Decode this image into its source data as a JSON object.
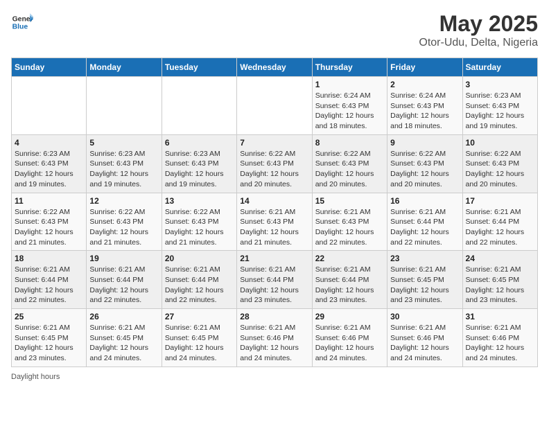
{
  "header": {
    "logo_line1": "General",
    "logo_line2": "Blue",
    "title": "May 2025",
    "subtitle": "Otor-Udu, Delta, Nigeria"
  },
  "days_of_week": [
    "Sunday",
    "Monday",
    "Tuesday",
    "Wednesday",
    "Thursday",
    "Friday",
    "Saturday"
  ],
  "weeks": [
    [
      {
        "day": "",
        "info": ""
      },
      {
        "day": "",
        "info": ""
      },
      {
        "day": "",
        "info": ""
      },
      {
        "day": "",
        "info": ""
      },
      {
        "day": "1",
        "info": "Sunrise: 6:24 AM\nSunset: 6:43 PM\nDaylight: 12 hours and 18 minutes."
      },
      {
        "day": "2",
        "info": "Sunrise: 6:24 AM\nSunset: 6:43 PM\nDaylight: 12 hours and 18 minutes."
      },
      {
        "day": "3",
        "info": "Sunrise: 6:23 AM\nSunset: 6:43 PM\nDaylight: 12 hours and 19 minutes."
      }
    ],
    [
      {
        "day": "4",
        "info": "Sunrise: 6:23 AM\nSunset: 6:43 PM\nDaylight: 12 hours and 19 minutes."
      },
      {
        "day": "5",
        "info": "Sunrise: 6:23 AM\nSunset: 6:43 PM\nDaylight: 12 hours and 19 minutes."
      },
      {
        "day": "6",
        "info": "Sunrise: 6:23 AM\nSunset: 6:43 PM\nDaylight: 12 hours and 19 minutes."
      },
      {
        "day": "7",
        "info": "Sunrise: 6:22 AM\nSunset: 6:43 PM\nDaylight: 12 hours and 20 minutes."
      },
      {
        "day": "8",
        "info": "Sunrise: 6:22 AM\nSunset: 6:43 PM\nDaylight: 12 hours and 20 minutes."
      },
      {
        "day": "9",
        "info": "Sunrise: 6:22 AM\nSunset: 6:43 PM\nDaylight: 12 hours and 20 minutes."
      },
      {
        "day": "10",
        "info": "Sunrise: 6:22 AM\nSunset: 6:43 PM\nDaylight: 12 hours and 20 minutes."
      }
    ],
    [
      {
        "day": "11",
        "info": "Sunrise: 6:22 AM\nSunset: 6:43 PM\nDaylight: 12 hours and 21 minutes."
      },
      {
        "day": "12",
        "info": "Sunrise: 6:22 AM\nSunset: 6:43 PM\nDaylight: 12 hours and 21 minutes."
      },
      {
        "day": "13",
        "info": "Sunrise: 6:22 AM\nSunset: 6:43 PM\nDaylight: 12 hours and 21 minutes."
      },
      {
        "day": "14",
        "info": "Sunrise: 6:21 AM\nSunset: 6:43 PM\nDaylight: 12 hours and 21 minutes."
      },
      {
        "day": "15",
        "info": "Sunrise: 6:21 AM\nSunset: 6:43 PM\nDaylight: 12 hours and 22 minutes."
      },
      {
        "day": "16",
        "info": "Sunrise: 6:21 AM\nSunset: 6:44 PM\nDaylight: 12 hours and 22 minutes."
      },
      {
        "day": "17",
        "info": "Sunrise: 6:21 AM\nSunset: 6:44 PM\nDaylight: 12 hours and 22 minutes."
      }
    ],
    [
      {
        "day": "18",
        "info": "Sunrise: 6:21 AM\nSunset: 6:44 PM\nDaylight: 12 hours and 22 minutes."
      },
      {
        "day": "19",
        "info": "Sunrise: 6:21 AM\nSunset: 6:44 PM\nDaylight: 12 hours and 22 minutes."
      },
      {
        "day": "20",
        "info": "Sunrise: 6:21 AM\nSunset: 6:44 PM\nDaylight: 12 hours and 22 minutes."
      },
      {
        "day": "21",
        "info": "Sunrise: 6:21 AM\nSunset: 6:44 PM\nDaylight: 12 hours and 23 minutes."
      },
      {
        "day": "22",
        "info": "Sunrise: 6:21 AM\nSunset: 6:44 PM\nDaylight: 12 hours and 23 minutes."
      },
      {
        "day": "23",
        "info": "Sunrise: 6:21 AM\nSunset: 6:45 PM\nDaylight: 12 hours and 23 minutes."
      },
      {
        "day": "24",
        "info": "Sunrise: 6:21 AM\nSunset: 6:45 PM\nDaylight: 12 hours and 23 minutes."
      }
    ],
    [
      {
        "day": "25",
        "info": "Sunrise: 6:21 AM\nSunset: 6:45 PM\nDaylight: 12 hours and 23 minutes."
      },
      {
        "day": "26",
        "info": "Sunrise: 6:21 AM\nSunset: 6:45 PM\nDaylight: 12 hours and 24 minutes."
      },
      {
        "day": "27",
        "info": "Sunrise: 6:21 AM\nSunset: 6:45 PM\nDaylight: 12 hours and 24 minutes."
      },
      {
        "day": "28",
        "info": "Sunrise: 6:21 AM\nSunset: 6:46 PM\nDaylight: 12 hours and 24 minutes."
      },
      {
        "day": "29",
        "info": "Sunrise: 6:21 AM\nSunset: 6:46 PM\nDaylight: 12 hours and 24 minutes."
      },
      {
        "day": "30",
        "info": "Sunrise: 6:21 AM\nSunset: 6:46 PM\nDaylight: 12 hours and 24 minutes."
      },
      {
        "day": "31",
        "info": "Sunrise: 6:21 AM\nSunset: 6:46 PM\nDaylight: 12 hours and 24 minutes."
      }
    ]
  ],
  "footer": {
    "daylight_label": "Daylight hours"
  }
}
